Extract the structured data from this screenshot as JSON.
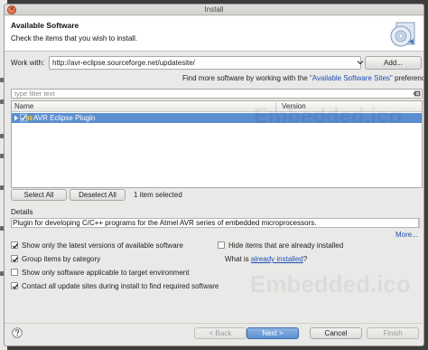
{
  "window": {
    "title": "Install"
  },
  "banner": {
    "title": "Available Software",
    "subtitle": "Check the items that you wish to install."
  },
  "work_with": {
    "label": "Work with:",
    "value": "http://avr-eclipse.sourceforge.net/updatesite/",
    "add_label": "Add...",
    "hint_prefix": "Find more software by working with the ",
    "hint_link": "\"Available Software Sites\"",
    "hint_suffix": " preferences."
  },
  "filter": {
    "placeholder": "type filter text"
  },
  "table": {
    "columns": [
      "Name",
      "Version"
    ],
    "rows": [
      {
        "name": "AVR Eclipse Plugin",
        "version": "",
        "checked": true,
        "selected": true
      }
    ]
  },
  "selection": {
    "select_all_label": "Select All",
    "deselect_all_label": "Deselect All",
    "status": "1 item selected"
  },
  "details": {
    "label": "Details",
    "text": "Plugin for developing C/C++ programs for the Atmel AVR series of embedded microprocessors.",
    "more_label": "More..."
  },
  "options": {
    "latest_versions": {
      "label": "Show only the latest versions of available software",
      "checked": true
    },
    "group_by_category": {
      "label": "Group items by category",
      "checked": true
    },
    "target_env": {
      "label": "Show only software applicable to target environment",
      "checked": false
    },
    "contact_sites": {
      "label": "Contact all update sites during install to find required software",
      "checked": true
    },
    "hide_installed": {
      "label": "Hide items that are already installed",
      "checked": false
    },
    "what_is_prefix": "What is ",
    "already_installed_link": "already installed",
    "what_is_suffix": "?"
  },
  "buttons": {
    "back": "< Back",
    "next": "Next >",
    "cancel": "Cancel",
    "finish": "Finish"
  },
  "icons": {
    "close": "close-icon",
    "banner": "install-cd-icon",
    "combo": "chevron-down-icon",
    "filter_clear": "clear-filter-icon",
    "help": "help-icon",
    "plugin": "plugin-icon"
  },
  "colors": {
    "accent": "#5b8ed0",
    "link": "#1e4fb6",
    "close": "#d5502a"
  },
  "watermark": "Embedded.ico"
}
